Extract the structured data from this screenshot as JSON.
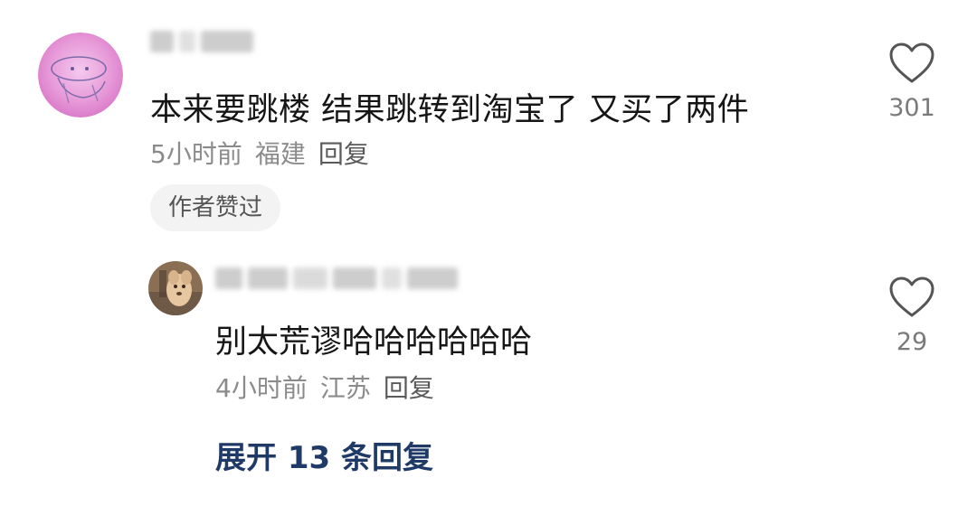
{
  "comment": {
    "text": "本来要跳楼 结果跳转到淘宝了 又买了两件",
    "time": "5小时前",
    "location": "福建",
    "reply_label": "回复",
    "author_badge": "作者赞过",
    "like_count": "301",
    "like_icon": "heart-outline-icon"
  },
  "reply": {
    "text": "别太荒谬哈哈哈哈哈哈",
    "time": "4小时前",
    "location": "江苏",
    "reply_label": "回复",
    "like_count": "29",
    "like_icon": "heart-outline-icon"
  },
  "expand_replies_label": "展开 13 条回复",
  "colors": {
    "accent_link": "#1f3a66",
    "meta_text": "#8b8b8b",
    "badge_bg": "#f3f3f3"
  }
}
